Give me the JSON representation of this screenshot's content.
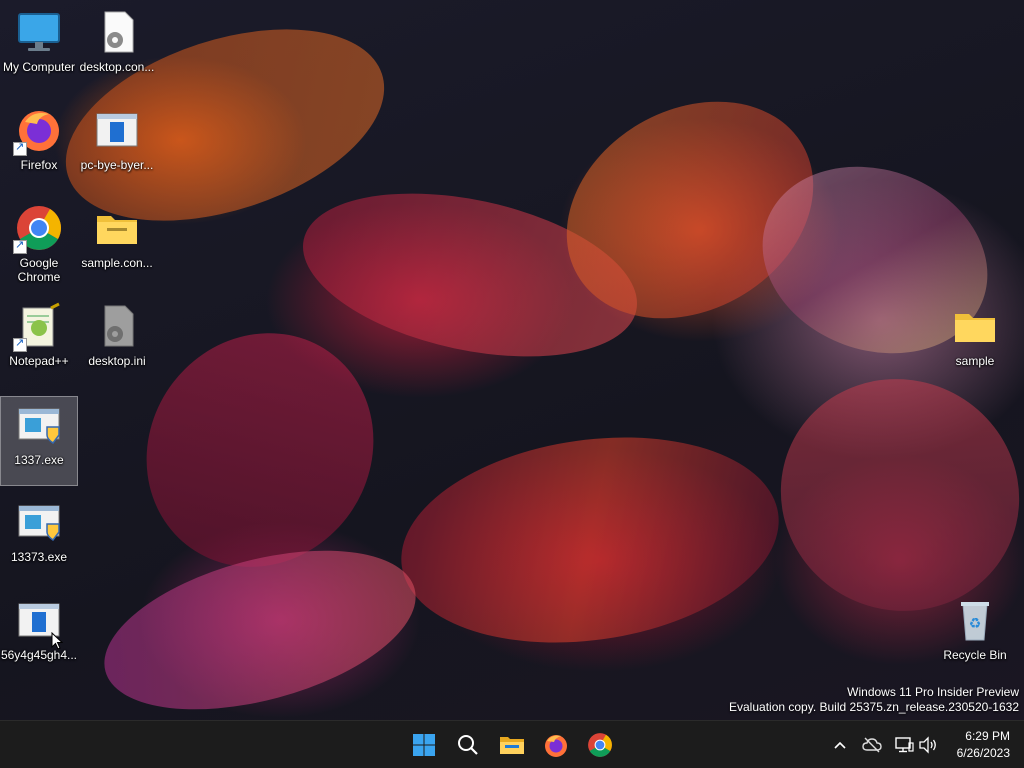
{
  "desktop": {
    "icons": [
      {
        "label": "My Computer"
      },
      {
        "label": "desktop.con..."
      },
      {
        "label": "Firefox"
      },
      {
        "label": "pc-bye-byer..."
      },
      {
        "label": "Google Chrome"
      },
      {
        "label": "sample.con..."
      },
      {
        "label": "Notepad++"
      },
      {
        "label": "desktop.ini"
      },
      {
        "label": "1337.exe"
      },
      {
        "label": "13373.exe"
      },
      {
        "label": "56y4g45gh4..."
      },
      {
        "label": "sample"
      },
      {
        "label": "Recycle Bin"
      }
    ],
    "watermark": {
      "line1": "Windows 11 Pro Insider Preview",
      "line2": "Evaluation copy. Build 25375.zn_release.230520-1632"
    }
  },
  "taskbar": {
    "pinned": [
      "start-icon",
      "search-icon",
      "file-explorer-icon",
      "firefox-icon",
      "chrome-icon"
    ],
    "tray": [
      "chevron-up-icon",
      "cloud-offline-icon",
      "network-icon",
      "volume-icon"
    ],
    "clock": {
      "time": "6:29 PM",
      "date": "6/26/2023"
    }
  },
  "colors": {
    "taskbar": "#1c1c1c",
    "accent": "#0078d4"
  }
}
